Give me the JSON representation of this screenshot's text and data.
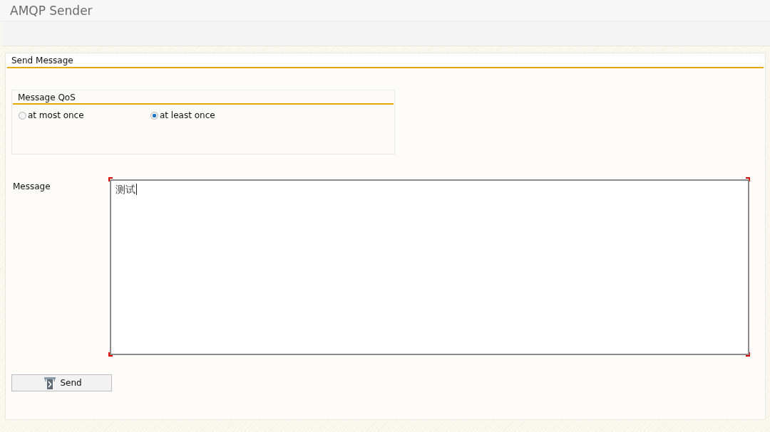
{
  "window": {
    "title": "AMQP Sender"
  },
  "panel": {
    "title": "Send Message",
    "qos_group": {
      "title": "Message QoS",
      "options": [
        {
          "label": "at most once",
          "selected": false
        },
        {
          "label": "at least once",
          "selected": true
        }
      ]
    },
    "message_field": {
      "label": "Message",
      "value": "测试",
      "focused": true
    },
    "buttons": [
      {
        "label": "Send",
        "kind": "send"
      }
    ]
  }
}
